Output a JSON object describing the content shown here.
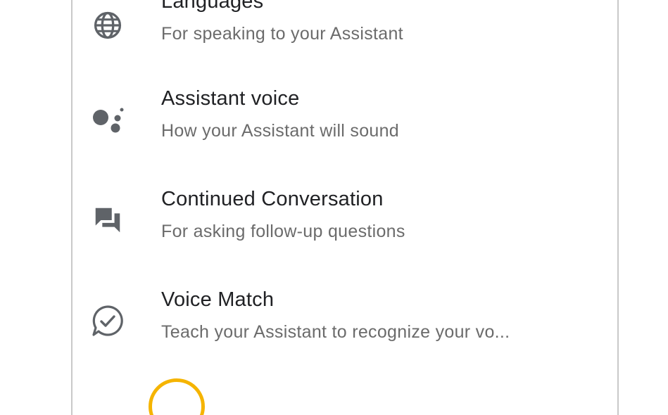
{
  "settings": {
    "items": [
      {
        "title": "Languages",
        "subtitle": "For speaking to your Assistant",
        "icon": "globe-icon"
      },
      {
        "title": "Assistant voice",
        "subtitle": "How your Assistant will sound",
        "icon": "assistant-dots-icon"
      },
      {
        "title": "Continued Conversation",
        "subtitle": "For asking follow-up questions",
        "icon": "chat-bubbles-icon"
      },
      {
        "title": "Voice Match",
        "subtitle": "Teach your Assistant to recognize your vo...",
        "icon": "voice-match-check-icon"
      }
    ]
  },
  "colors": {
    "title_text": "#202124",
    "subtitle_text": "#6b6b6b",
    "icon": "#5f6368",
    "frame_border": "#c9c9c9",
    "accent_ring": "#f5b400"
  }
}
